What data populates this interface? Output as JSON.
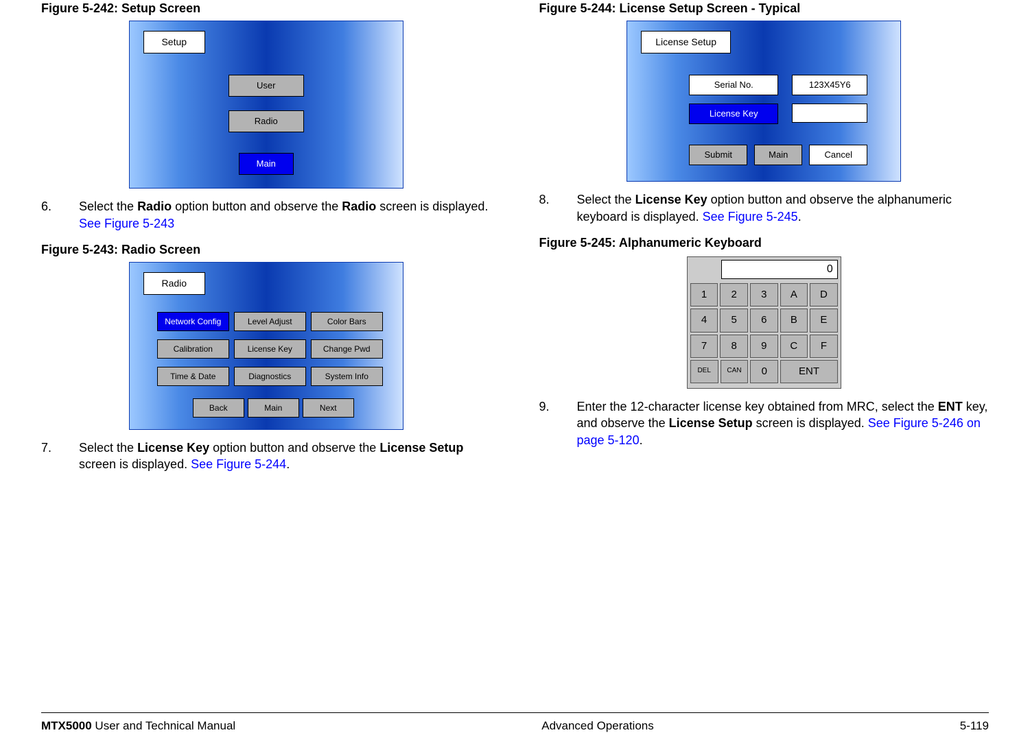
{
  "figures": {
    "242": {
      "caption": "Figure 5-242:   Setup Screen",
      "title": "Setup",
      "user": "User",
      "radio": "Radio",
      "main": "Main"
    },
    "243": {
      "caption": "Figure 5-243:   Radio Screen",
      "title": "Radio",
      "btns": {
        "network": "Network Config",
        "level": "Level Adjust",
        "color": "Color Bars",
        "cal": "Calibration",
        "lic": "License Key",
        "pwd": "Change Pwd",
        "time": "Time & Date",
        "diag": "Diagnostics",
        "sys": "System Info",
        "back": "Back",
        "main": "Main",
        "next": "Next"
      }
    },
    "244": {
      "caption": "Figure 5-244:   License Setup Screen - Typical",
      "title": "License Setup",
      "serial_lbl": "Serial No.",
      "serial_val": "123X45Y6",
      "lickey_lbl": "License Key",
      "submit": "Submit",
      "main": "Main",
      "cancel": "Cancel"
    },
    "245": {
      "caption": "Figure 5-245:   Alphanumeric Keyboard",
      "display": "0",
      "keys": {
        "1": "1",
        "2": "2",
        "3": "3",
        "A": "A",
        "D": "D",
        "4": "4",
        "5": "5",
        "6": "6",
        "B": "B",
        "E": "E",
        "7": "7",
        "8": "8",
        "9": "9",
        "C": "C",
        "F": "F",
        "del": "DEL",
        "can": "CAN",
        "0": "0",
        "ent": "ENT"
      }
    }
  },
  "steps": {
    "6": {
      "num": "6.",
      "text_a": "Select the ",
      "b1": "Radio",
      "text_b": " option button and observe the ",
      "b2": "Radio",
      "text_c": " screen is displayed.  ",
      "link": "See Figure 5-243"
    },
    "7": {
      "num": "7.",
      "text_a": "Select the ",
      "b1": "License Key",
      "text_b": " option button and observe the ",
      "b2": "License Setup",
      "text_c": " screen is displayed.  ",
      "link": "See Figure 5-244",
      "after": "."
    },
    "8": {
      "num": "8.",
      "text_a": "Select the ",
      "b1": "License Key",
      "text_b": " option button and observe the alphanumeric keyboard is displayed.  ",
      "link": "See Figure 5-245",
      "after": "."
    },
    "9": {
      "num": "9.",
      "text_a": "Enter the 12-character license key obtained from MRC, select the ",
      "b1": "ENT",
      "text_b": " key, and observe the ",
      "b2": "License Setup",
      "text_c": " screen is displayed.  ",
      "link": "See Figure 5-246 on page 5-120",
      "after": "."
    }
  },
  "footer": {
    "left_b": "MTX5000",
    "left": " User and Technical Manual",
    "center": "Advanced Operations",
    "right": "5-119"
  }
}
